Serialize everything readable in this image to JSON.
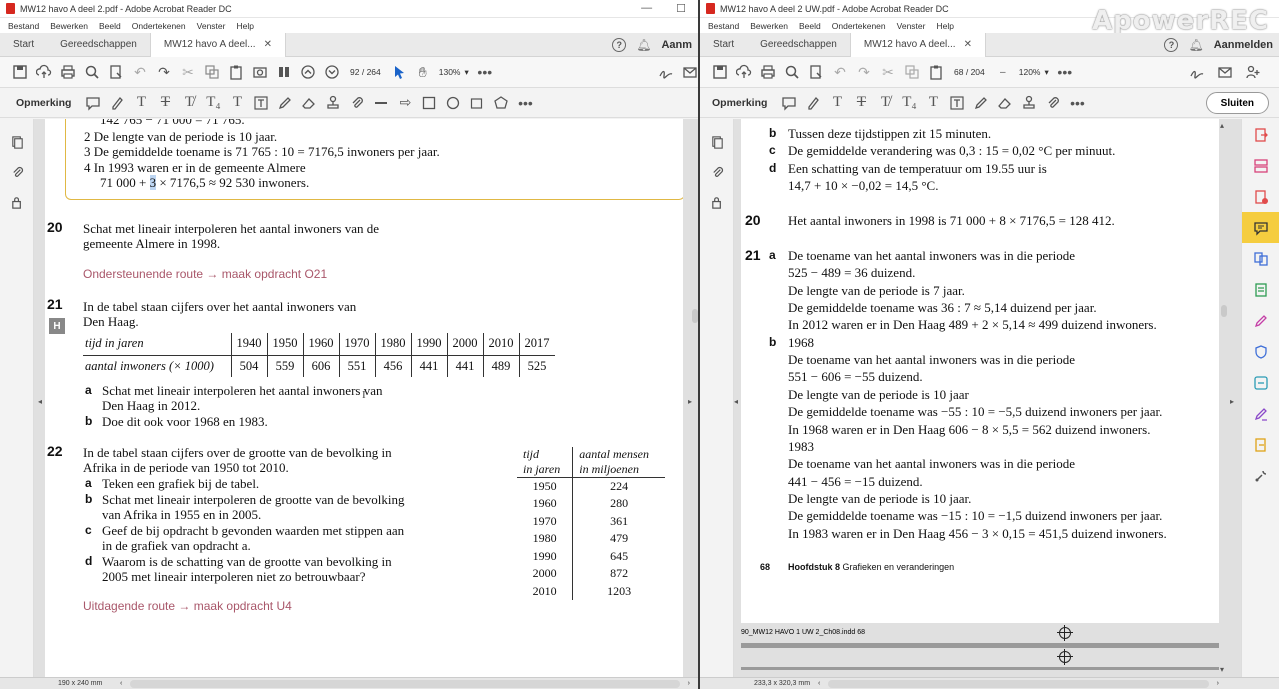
{
  "left": {
    "title": "MW12 havo A deel 2.pdf - Adobe Acrobat Reader DC",
    "menu": [
      "Bestand",
      "Bewerken",
      "Beeld",
      "Ondertekenen",
      "Venster",
      "Help"
    ],
    "tabs": [
      "Start",
      "Gereedschappen",
      "MW12 havo A deel..."
    ],
    "signin": "Aanm",
    "page_current": "92",
    "page_total": "/ 264",
    "zoom": "130%",
    "annot_label": "Opmerking",
    "status_size": "190 x 240 mm",
    "content": {
      "box_lines": [
        "142 765 − 71 000 = 71 765.",
        "2  De lengte van de periode is 10 jaar.",
        "3  De gemiddelde toename is 71 765 : 10 = 7176,5 inwoners per jaar.",
        "4  In 1993 waren er in de gemeente Almere",
        "× 7176,5 ≈ 92 530 inwoners."
      ],
      "box_line5_prefix": "71 000 + ",
      "box_line5_hl": "3",
      "q20_num": "20",
      "q20_lines": [
        "Schat met lineair interpoleren het aantal inwoners van de",
        "gemeente Almere in 1998."
      ],
      "route1": "Ondersteunende route → maak opdracht O21",
      "q21_num": "21",
      "q21_badge": "H",
      "q21_lines": [
        "In de tabel staan cijfers over het aantal inwoners van",
        "Den Haag."
      ],
      "table_row1_head": "tijd in jaren",
      "table_row2_head": "aantal inwoners (× 1000)",
      "years": [
        "1940",
        "1950",
        "1960",
        "1970",
        "1980",
        "1990",
        "2000",
        "2010",
        "2017"
      ],
      "inhabitants": [
        "504",
        "559",
        "606",
        "551",
        "456",
        "441",
        "441",
        "489",
        "525"
      ],
      "q21a_label": "a",
      "q21a_lines": [
        "Schat met lineair interpoleren het aantal inwoners van",
        "Den Haag in 2012."
      ],
      "q21b_label": "b",
      "q21b": "Doe dit ook voor 1968 en 1983.",
      "q22_num": "22",
      "q22_lines": [
        "In de tabel staan cijfers over de grootte van de bevolking in",
        "Afrika in de periode van 1950 tot 2010."
      ],
      "q22_items": [
        {
          "label": "a",
          "lines": [
            "Teken een grafiek bij de tabel."
          ]
        },
        {
          "label": "b",
          "lines": [
            "Schat met lineair interpoleren de grootte van de bevolking",
            "van Afrika in 1955 en in 2005."
          ]
        },
        {
          "label": "c",
          "lines": [
            "Geef de bij opdracht b gevonden waarden met stippen aan",
            "in de grafiek van opdracht a."
          ]
        },
        {
          "label": "d",
          "lines": [
            "Waarom is de schatting van de grootte van bevolking in",
            "2005 met lineair interpoleren niet zo betrouwbaar?"
          ]
        }
      ],
      "afr_head1": [
        "tijd",
        "aantal mensen"
      ],
      "afr_head2": [
        "in jaren",
        "in miljoenen"
      ],
      "afr_years": [
        "1950",
        "1960",
        "1970",
        "1980",
        "1990",
        "2000",
        "2010"
      ],
      "afr_values": [
        "224",
        "280",
        "361",
        "479",
        "645",
        "872",
        "1203"
      ],
      "route2": "Uitdagende route → maak opdracht U4"
    }
  },
  "right": {
    "title": "MW12 havo A deel 2 UW.pdf - Adobe Acrobat Reader DC",
    "menu": [
      "Bestand",
      "Bewerken",
      "Beeld",
      "Ondertekenen",
      "Venster",
      "Help"
    ],
    "tabs": [
      "Start",
      "Gereedschappen",
      "MW12 havo A deel..."
    ],
    "signin": "Aanmelden",
    "page_current": "68",
    "page_total": "/ 204",
    "zoom": "120%",
    "annot_label": "Opmerking",
    "close_button": "Sluiten",
    "status_size": "233,3 x 320,3 mm",
    "watermark": "ApowerREC",
    "content": {
      "top_lines": [
        {
          "label": "b",
          "text": "Tussen deze tijdstippen zit 15 minuten."
        },
        {
          "label": "c",
          "text": "De gemiddelde verandering was 0,3 : 15 = 0,02 °C per minuut."
        },
        {
          "label": "d",
          "text": "Een schatting van de temperatuur om 19.55 uur is"
        },
        {
          "label": "",
          "text": "14,7 + 10 × −0,02 = 14,5 °C."
        }
      ],
      "a20_num": "20",
      "a20": "Het aantal inwoners in 1998 is 71 000 + 8 × 7176,5 = 128 412.",
      "a21_num": "21",
      "a21_lines": [
        {
          "label": "a",
          "text": "De toename van het aantal inwoners was in die periode"
        },
        {
          "label": "",
          "text": "525 − 489 = 36 duizend."
        },
        {
          "label": "",
          "text": "De lengte van de periode is 7 jaar."
        },
        {
          "label": "",
          "text": "De gemiddelde toename was 36 : 7 ≈ 5,14 duizend per jaar."
        },
        {
          "label": "",
          "text": "In 2012 waren er in Den Haag 489 + 2 × 5,14 ≈ 499 duizend inwoners."
        },
        {
          "label": "b",
          "text": "1968"
        },
        {
          "label": "",
          "text": "De toename van het aantal inwoners was in die periode"
        },
        {
          "label": "",
          "text": "551 − 606 = −55 duizend."
        },
        {
          "label": "",
          "text": "De lengte van de periode is 10 jaar"
        },
        {
          "label": "",
          "text": "De gemiddelde toename was −55 : 10 = −5,5 duizend inwoners per jaar."
        },
        {
          "label": "",
          "text": "In 1968 waren er in Den Haag 606 − 8 × 5,5 = 562 duizend inwoners."
        },
        {
          "label": "",
          "text": "1983"
        },
        {
          "label": "",
          "text": "De toename van het aantal inwoners was in die periode"
        },
        {
          "label": "",
          "text": "441 − 456 = −15 duizend."
        },
        {
          "label": "",
          "text": "De lengte van de periode is 10 jaar."
        },
        {
          "label": "",
          "text": "De gemiddelde toename was −15 : 10 = −1,5 duizend inwoners per jaar."
        },
        {
          "label": "",
          "text": "In 1983 waren er in Den Haag 456 − 3 × 0,15 = 451,5 duizend inwoners."
        }
      ],
      "footer_page": "68",
      "footer_chapter": "Hoofdstuk 8",
      "footer_title": "Grafieken en veranderingen",
      "indd_line": "90_MW12 HAVO 1 UW 2_Ch08.indd   68"
    }
  }
}
